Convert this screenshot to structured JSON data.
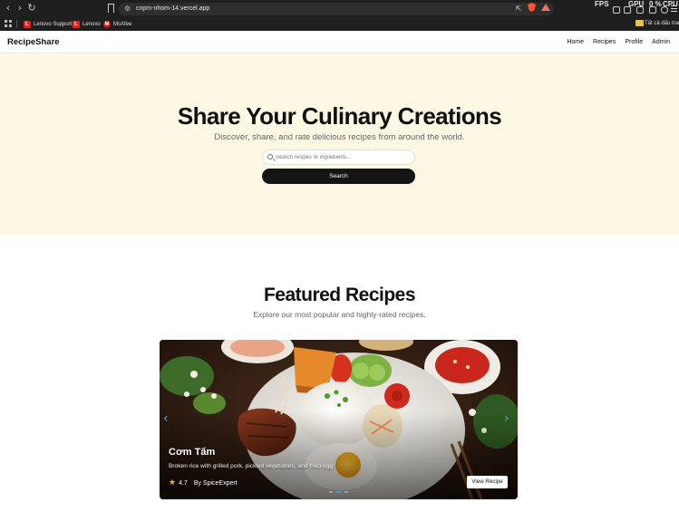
{
  "browser": {
    "url": "cnpm-nhom-14.vercel.app",
    "perf_labels": [
      "FPS",
      "GPU",
      "0 %",
      "CPU"
    ],
    "bookmarks": [
      {
        "label": "Lenovo Support",
        "icon": "lenovo-icon"
      },
      {
        "label": "Lenovo",
        "icon": "lenovo-icon"
      },
      {
        "label": "McAfee",
        "icon": "mcafee-icon"
      }
    ],
    "all_bookmarks_label": "Tất cả dấu trang"
  },
  "site": {
    "brand": "RecipeShare",
    "nav": [
      "Home",
      "Recipes",
      "Profile",
      "Admin"
    ]
  },
  "hero": {
    "title": "Share Your Culinary Creations",
    "subtitle": "Discover, share, and rate delicious recipes from around the world.",
    "search_placeholder": "Search recipes or ingredients...",
    "search_button": "Search",
    "background_color": "#fdf8e4"
  },
  "featured": {
    "title": "Featured Recipes",
    "subtitle": "Explore our most popular and highly-rated recipes.",
    "carousel": {
      "active_index": 1,
      "slide_count": 3,
      "recipe": {
        "name": "Cơm Tấm",
        "description": "Broken rice with grilled pork, pickled vegetables, and fried egg",
        "rating": "4.7",
        "author": "By SpiceExpert",
        "button": "View Recipe"
      }
    }
  }
}
